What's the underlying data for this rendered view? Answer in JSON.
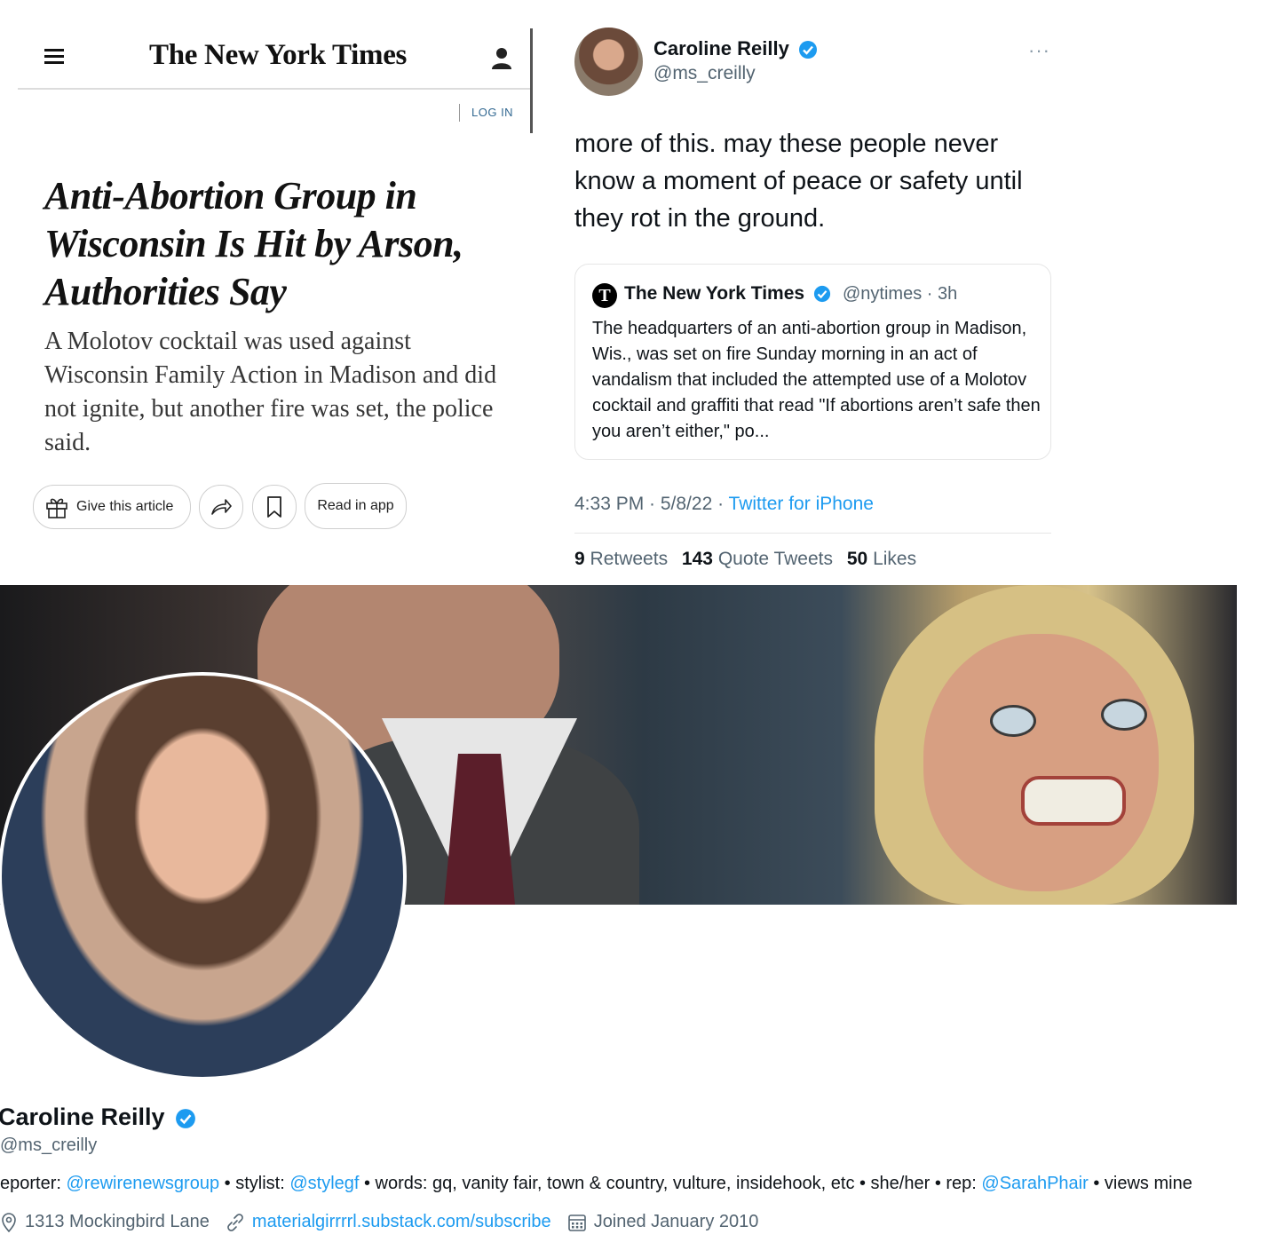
{
  "nyt": {
    "logo": "The New York Times",
    "login": "LOG IN",
    "headline": "Anti-Abortion Group in Wisconsin Is Hit by Arson, Authorities Say",
    "dek": "A Molotov cocktail was used against Wisconsin Family Action in Madison and did not ignite, but another fire was set, the police said.",
    "gift_label": "Give this article",
    "read_in_app_label": "Read in app"
  },
  "tweet": {
    "author_name": "Caroline Reilly",
    "author_handle": "@ms_creilly",
    "more": "···",
    "text": "more of this. may these people never know a moment of peace or safety until they rot in the ground.",
    "quote": {
      "author": "The New York Times",
      "meta": "@nytimes · 3h",
      "text": "The headquarters of an anti-abortion group in Madison, Wis., was set on fire Sunday morning in an act of vandalism that included the attempted use of a Molotov cocktail and graffiti that read \"If abortions aren’t safe then you aren’t either,\" po..."
    },
    "time": "4:33 PM · 5/8/22 · ",
    "source": "Twitter for iPhone",
    "retweets_count": "9",
    "retweets_label": "Retweets",
    "quotes_count": "143",
    "quotes_label": "Quote Tweets",
    "likes_count": "50",
    "likes_label": "Likes"
  },
  "profile": {
    "name": "Caroline Reilly",
    "handle": "@ms_creilly",
    "bio": {
      "p1": "eporter: ",
      "l1": "@rewirenewsgroup",
      "p2": " • stylist: ",
      "l2": "@stylegf",
      "p3": " • words: gq, vanity fair, town & country, vulture, insidehook, etc • she/her • rep: ",
      "l3": "@SarahPhair",
      "p4": " • views mine"
    },
    "location": "1313 Mockingbird Lane",
    "website": "materialgirrrrl.substack.com/subscribe",
    "joined": "Joined January 2010"
  },
  "colors": {
    "twitter_blue": "#1d9bf0",
    "nyt_link": "#326891",
    "muted_text": "#536471"
  }
}
